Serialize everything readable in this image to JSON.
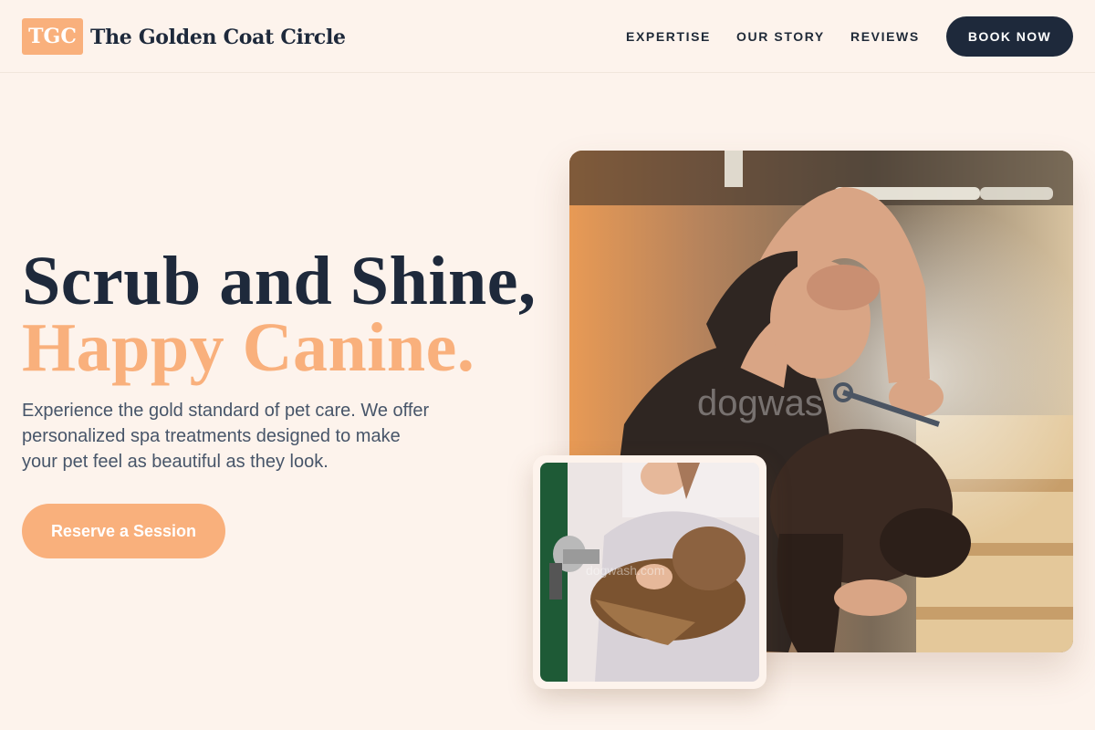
{
  "brand": {
    "badge": "TGC",
    "name": "The Golden Coat Circle"
  },
  "nav": {
    "items": [
      {
        "label": "EXPERTISE"
      },
      {
        "label": "OUR STORY"
      },
      {
        "label": "REVIEWS"
      }
    ],
    "book_label": "BOOK NOW"
  },
  "hero": {
    "headline_line1": "Scrub and Shine,",
    "headline_line2": "Happy Canine.",
    "subtext": "Experience the gold standard of pet care. We offer personalized spa treatments designed to make your pet feel as beautiful as they look.",
    "cta_label": "Reserve a Session"
  },
  "photos": {
    "main_watermark": "dogwas",
    "small_watermark": "dogwash.com"
  },
  "colors": {
    "background": "#fdf3ec",
    "accent": "#f9b07c",
    "navy": "#1e293b",
    "body_text": "#475569"
  }
}
